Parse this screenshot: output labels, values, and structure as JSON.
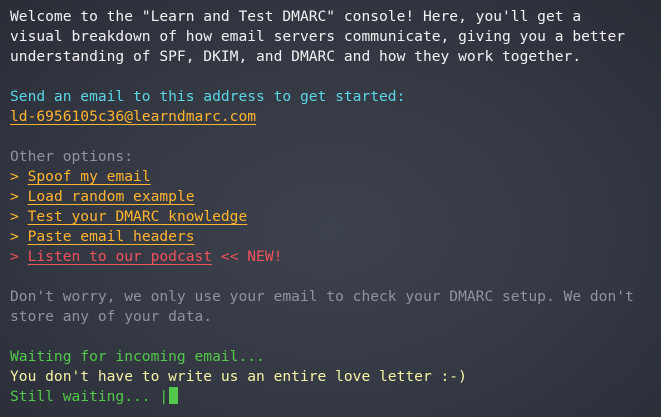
{
  "intro": {
    "line1": "Welcome to the \"Learn and Test DMARC\" console! Here, you'll get a",
    "line2": "visual breakdown of how email servers communicate, giving you a better",
    "line3": "understanding of SPF, DKIM, and DMARC and how they work together."
  },
  "start": {
    "prompt": "Send an email to this address to get started:",
    "address": "ld-6956105c36@learndmarc.com"
  },
  "options": {
    "heading": "Other options:",
    "marker": ">",
    "items": [
      {
        "label": "Spoof my email"
      },
      {
        "label": "Load random example"
      },
      {
        "label": "Test your DMARC knowledge"
      },
      {
        "label": "Paste email headers"
      },
      {
        "label": "Listen to our podcast",
        "badge": "<< NEW!"
      }
    ]
  },
  "privacy": {
    "line1": "Don't worry, we only use your email to check your DMARC setup. We don't",
    "line2": "store any of your data."
  },
  "status": {
    "waiting": "Waiting for incoming email...",
    "joke": "You don't have to write us an entire love letter :-)",
    "still": "Still waiting... |"
  },
  "colors": {
    "text": "#f2f2f2",
    "accent_cyan": "#5ad7e6",
    "link_orange": "#ffb52e",
    "muted_gray": "#8f939c",
    "highlight_red": "#f0525b",
    "status_green": "#52c94a",
    "message_yellow": "#f6f3a6"
  }
}
